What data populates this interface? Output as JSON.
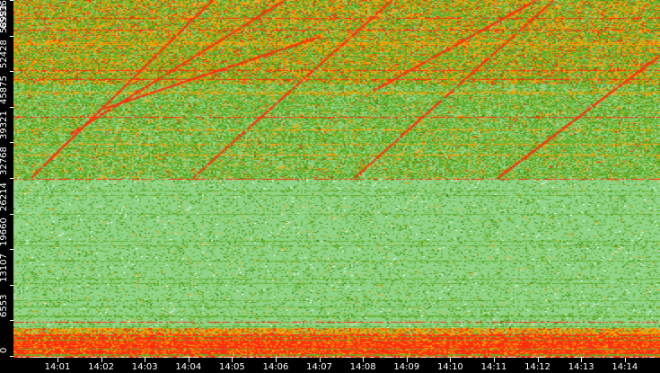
{
  "chart_data": {
    "type": "heatmap",
    "title": "",
    "xlabel": "",
    "ylabel": "",
    "ylim": [
      0,
      65536
    ],
    "y_ticks": [
      "0",
      "6553",
      "13107",
      "19660",
      "26214",
      "32768",
      "39321",
      "45875",
      "52428",
      "58982",
      "65536"
    ],
    "y_tick_values": [
      0,
      6553,
      13107,
      19660,
      26214,
      32768,
      39321,
      45875,
      52428,
      58982,
      65536
    ],
    "x_ticks": [
      "14:01",
      "14:02",
      "14:03",
      "14:04",
      "14:05",
      "14:06",
      "14:07",
      "14:08",
      "14:09",
      "14:10",
      "14:11",
      "14:12",
      "14:13",
      "14:14"
    ],
    "x_range_minutes": [
      0.0,
      14.85
    ],
    "color_scale": [
      "#90d488",
      "#62b02a",
      "#3f8a10",
      "#ffa000",
      "#ff3010",
      "#ffffff"
    ],
    "bands": [
      {
        "range": [
          0,
          4000
        ],
        "level": "high"
      },
      {
        "range": [
          4000,
          5200
        ],
        "level": "medium"
      },
      {
        "range": [
          5200,
          32768
        ],
        "level": "low"
      },
      {
        "range": [
          32768,
          50000
        ],
        "level": "mixed"
      },
      {
        "range": [
          50000,
          65536
        ],
        "level": "mixed-high"
      }
    ],
    "hot_lines": [
      6300,
      32600,
      52600,
      62300,
      51000,
      60000,
      44000
    ]
  }
}
